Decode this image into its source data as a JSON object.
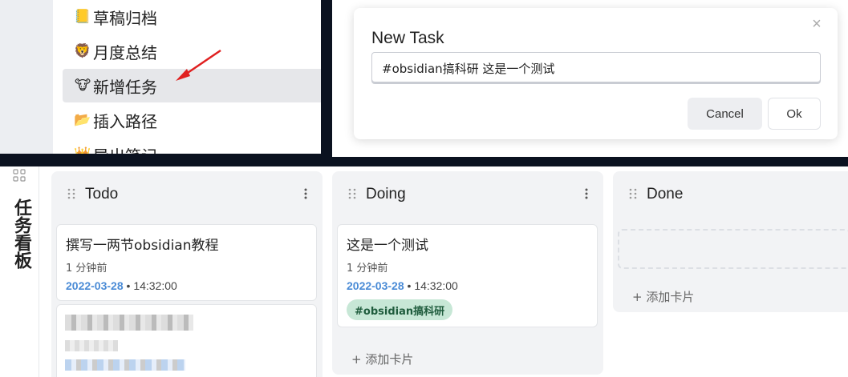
{
  "menu": {
    "items": [
      {
        "icon": "📒",
        "label": "草稿归档"
      },
      {
        "icon": "🦁",
        "label": "月度总结"
      },
      {
        "icon": "🐮",
        "label": "新增任务"
      },
      {
        "icon": "📂",
        "label": "插入路径"
      },
      {
        "icon": "👑",
        "label": "导出笔记"
      }
    ]
  },
  "dialog": {
    "title": "New Task",
    "input_value": "#obsidian搞科研 这是一个测试",
    "cancel_label": "Cancel",
    "ok_label": "Ok"
  },
  "board": {
    "title": "任务看板",
    "columns": [
      {
        "title": "Todo",
        "cards": [
          {
            "title": "撰写一两节obsidian教程",
            "time_ago": "1 分钟前",
            "date": "2022-03-28",
            "time": "14:32:00"
          }
        ]
      },
      {
        "title": "Doing",
        "cards": [
          {
            "title": "这是一个测试",
            "time_ago": "1 分钟前",
            "date": "2022-03-28",
            "time": "14:32:00",
            "tag": "#obsidian搞科研"
          }
        ],
        "add_card": "+ 添加卡片"
      },
      {
        "title": "Done",
        "cards": [],
        "add_card": "+ 添加卡片"
      }
    ]
  },
  "colors": {
    "date_blue": "#4a8bd6",
    "tag_bg": "#c7e7d6",
    "arrow_red": "#e02020"
  }
}
